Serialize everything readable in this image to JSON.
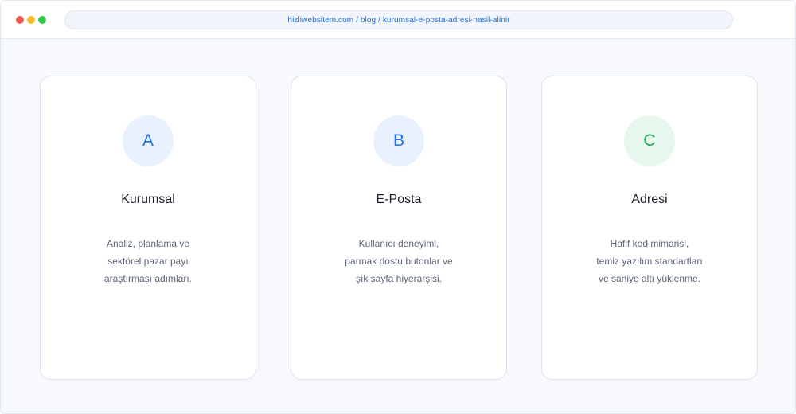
{
  "browser": {
    "url": "hizliwebsitem.com / blog / kurumsal-e-posta-adresi-nasil-alinir"
  },
  "cards": [
    {
      "badge": "A",
      "badge_color": "#1f73e0",
      "title": "Kurumsal",
      "lines": [
        "Analiz, planlama ve",
        "sektörel pazar payı",
        "araştırması adımları."
      ]
    },
    {
      "badge": "B",
      "badge_color": "#1f73e0",
      "title": "E-Posta",
      "lines": [
        "Kullanıcı deneyimi,",
        "parmak dostu butonlar ve",
        "şık sayfa hiyerarşisi."
      ]
    },
    {
      "badge": "C",
      "badge_color": "#22a95a",
      "title": "Adresi",
      "lines": [
        "Hafif kod mimarisi,",
        "temiz yazılım standartları",
        "ve saniye altı yüklenme."
      ]
    }
  ]
}
